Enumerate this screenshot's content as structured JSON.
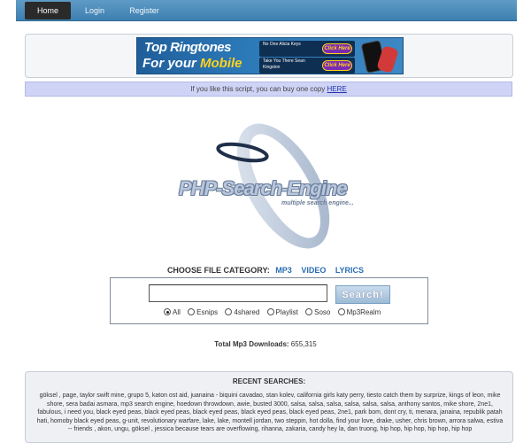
{
  "nav": {
    "items": [
      {
        "label": "Home"
      },
      {
        "label": "Login"
      },
      {
        "label": "Register"
      }
    ]
  },
  "ad": {
    "title_line1": "Top Ringtones",
    "title_line2_prefix": "For your ",
    "title_line2_highlight": "Mobile",
    "rows": [
      {
        "text": "No One Alicia Keys",
        "button": "Click Here"
      },
      {
        "text": "Take You There Sean Kingston",
        "button": "Click Here"
      }
    ]
  },
  "notice": {
    "text": "If you like this script, you can buy one copy ",
    "link": "HERE"
  },
  "logo": {
    "title": "PHP-Search-Engine",
    "subtitle": "multiple search engine..."
  },
  "category": {
    "label": "CHOOSE FILE CATEGORY:",
    "options": [
      "MP3",
      "VIDEO",
      "LYRICS"
    ]
  },
  "search": {
    "value": "",
    "button": "Search!",
    "sources": [
      {
        "label": "All",
        "selected": true
      },
      {
        "label": "Esnips",
        "selected": false
      },
      {
        "label": "4shared",
        "selected": false
      },
      {
        "label": "Playlist",
        "selected": false
      },
      {
        "label": "Soso",
        "selected": false
      },
      {
        "label": "Mp3Realm",
        "selected": false
      }
    ]
  },
  "total": {
    "label": "Total Mp3 Downloads:",
    "value": "655,315"
  },
  "recent": {
    "title": "RECENT SEARCHES:",
    "terms": "göksel , page, taylor swift mine, grupo 5, katon ost aid, juanaina - biquini cavadao, stan kolev, california girls katy perry, tiesto catch them by surprize, kings of leon, mike shore, sera badai asmara, mp3 search engine, hoedown throwdown, awie, busted 3000, salsa, salsa, salsa, salsa, salsa, salsa, anthony santos, mike shore, 2ne1, fabulous, i need you, black eyed peas, black eyed peas, black eyed peas, black eyed peas, black eyed peas, 2ne1, park bom, dont cry, ti, menara, janaina, republik patah hati, homoby black eyed peas, g-unit, revolutionary warfare, lake, lake, montell jordan, two steppin, hot dolla, find your love, drake, usher, chris brown, arrora salwa, estiva -- friends , akon, ungu, göksel , jessica because tears are overflowing, rihanna, zakaria, candy hey la, dan truong, hip hop, hip hop, hip hop, hip hop"
  },
  "colors": {
    "nav_bg": "#4a8bbd",
    "notice_bg": "#cfd3f5",
    "link": "#2a6db3"
  }
}
